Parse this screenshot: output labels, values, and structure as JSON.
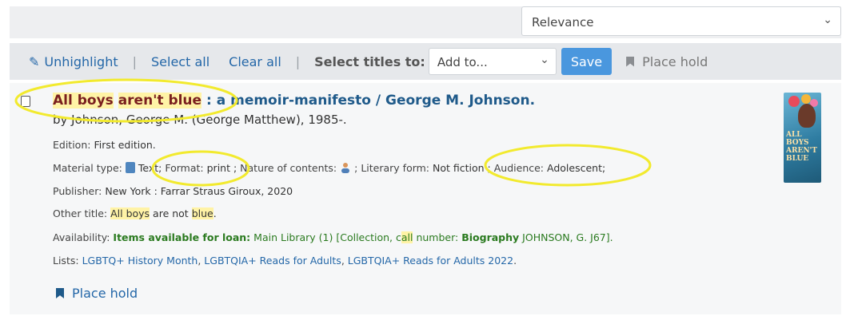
{
  "header_cut_text": "",
  "sort": {
    "selected": "Relevance"
  },
  "toolbar": {
    "unhighlight": "Unhighlight",
    "sep1": "|",
    "select_all": "Select all",
    "clear_all": "Clear all",
    "sep2": "|",
    "select_titles_label": "Select titles to:",
    "add_to": "Add to...",
    "save": "Save",
    "place_hold": "Place hold"
  },
  "result": {
    "title_hl_1": "All boys",
    "title_mid": " ",
    "title_hl_2": "aren't blue",
    "title_rest": " : a memoir-manifesto / George M. Johnson.",
    "author": "by Johnson, George M. (George Matthew), 1985-.",
    "edition_label": "Edition:",
    "edition_value": "First edition.",
    "material_label": "Material type:",
    "material_value": "Text;",
    "format_label": "Format:",
    "format_value": "print ;",
    "nature_label": "Nature of contents:",
    "literary_label": "; Literary form:",
    "literary_value": "Not fiction ;",
    "audience_label": "Audience:",
    "audience_value": "Adolescent;",
    "publisher_label": "Publisher:",
    "publisher_value": "New York : Farrar Straus Giroux, 2020",
    "other_title_label": "Other title:",
    "other_title_hl1": "All boys",
    "other_title_mid": " are not ",
    "other_title_hl2": "blue",
    "other_title_end": ".",
    "availability_label": "Availability:",
    "availability_items": "Items available for loan:",
    "availability_lib": "Main Library (1) [Collection, c",
    "availability_all": "all",
    "availability_num": " number:",
    "availability_bio": "Biography",
    "availability_call": "JOHNSON, G. J67].",
    "lists_label": "Lists:",
    "list_1": "LGBTQ+ History Month",
    "list_2": "LGBTQIA+ Reads for Adults",
    "list_3": "LGBTQIA+ Reads for Adults 2022",
    "list_sep": ", ",
    "list_end": ".",
    "place_hold": "Place hold",
    "cover_text": "ALL BOYS AREN'T BLUE"
  },
  "colors": {
    "link": "#2467a8",
    "title": "#1f5a8a",
    "highlight": "#fff3a6",
    "save_button": "#4a97de",
    "annotation_ellipse": "#f2ea2e",
    "availability_green": "#2a7a1f"
  },
  "icons": {
    "unhighlight": "pencil-icon",
    "hold": "bookmark-icon",
    "material": "book-icon",
    "nature": "person-icon",
    "dropdown": "chevron-down-icon"
  }
}
